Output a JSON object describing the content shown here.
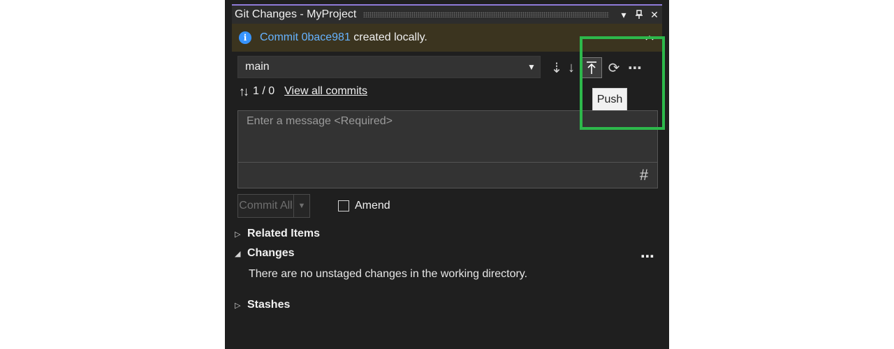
{
  "window": {
    "title": "Git Changes - MyProject",
    "dropdown_glyph": "▾",
    "pin_glyph": "📌",
    "close_glyph": "✕"
  },
  "info_bar": {
    "icon_glyph": "i",
    "prefix": "Commit ",
    "commit_id": "0bace981",
    "suffix": " created locally.",
    "collapse_glyph": "⌃"
  },
  "branch": {
    "selected": "main",
    "caret_glyph": "▼"
  },
  "toolbar": {
    "fetch_glyph": "⇣",
    "pull_glyph": "↓",
    "push_glyph": "⭱",
    "sync_glyph": "⟳",
    "more_glyph": "⋯",
    "tooltip": "Push"
  },
  "commits": {
    "arrows_glyph": "↑↓",
    "count": "1 / 0",
    "view_all": "View all commits"
  },
  "message": {
    "placeholder": "Enter a message <Required>",
    "hash_glyph": "#"
  },
  "commit_actions": {
    "commit_all": "Commit All",
    "caret_glyph": "▼",
    "amend": "Amend"
  },
  "sections": {
    "related": {
      "label": "Related Items",
      "chevron": "▷"
    },
    "changes": {
      "label": "Changes",
      "chevron": "◢",
      "more_glyph": "⋯",
      "empty": "There are no unstaged changes in the working directory."
    },
    "stashes": {
      "label": "Stashes",
      "chevron": "▷"
    }
  },
  "colors": {
    "panel_bg": "#1f1f1f",
    "info_bar_bg": "#3b341f",
    "link": "#66b3ff",
    "highlight": "#2db84b",
    "accent": "#8f7ad9"
  }
}
